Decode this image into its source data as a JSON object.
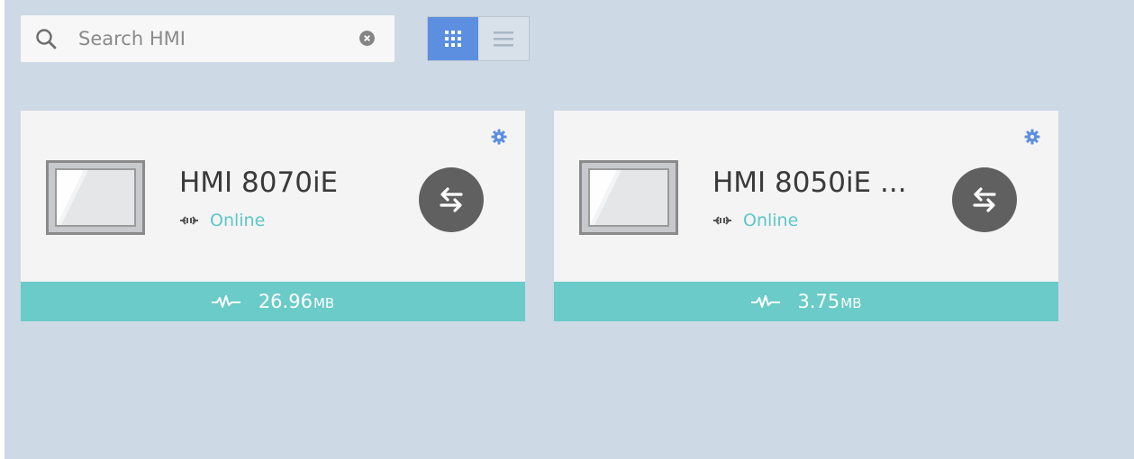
{
  "search": {
    "placeholder": "Search HMI",
    "value": ""
  },
  "view_toggle": {
    "active": "grid",
    "options": [
      "grid-icon",
      "list-icon"
    ]
  },
  "colors": {
    "background": "#cdd9e4",
    "accent": "#5c8fe0",
    "online": "#5ec6c9",
    "footer": "#6acbc8"
  },
  "devices": [
    {
      "name": "HMI 8070iE",
      "status": "Online",
      "storage_value": "26.96",
      "storage_unit": "MB"
    },
    {
      "name": "HMI 8050iE ...",
      "status": "Online",
      "storage_value": "3.75",
      "storage_unit": "MB"
    }
  ]
}
